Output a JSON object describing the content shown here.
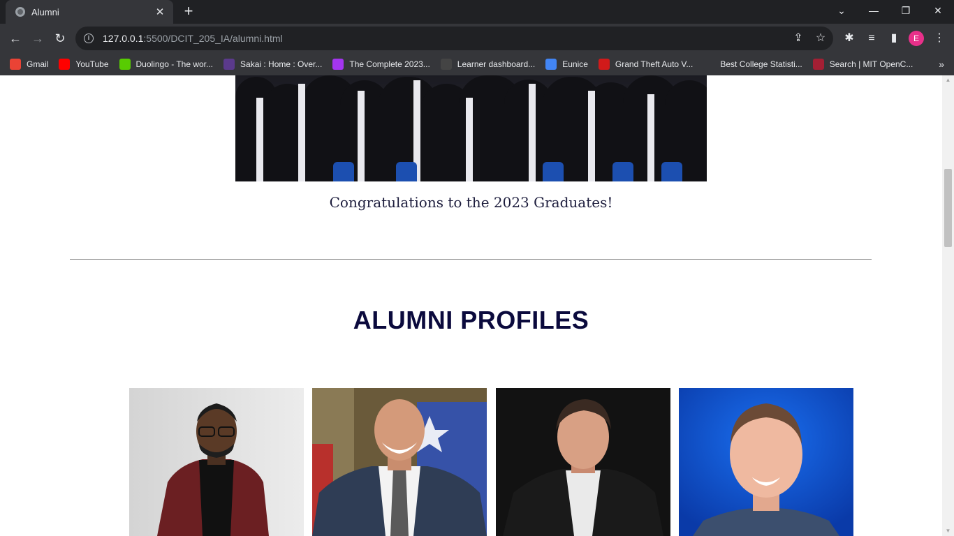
{
  "browser": {
    "tab_title": "Alumni",
    "tab_close": "✕",
    "new_tab": "+",
    "url_host": "127.0.0.1",
    "url_path": ":5500/DCIT_205_IA/alumni.html",
    "profile_initial": "E"
  },
  "bookmarks": [
    {
      "label": "Gmail",
      "icon": "gmail-icon",
      "color": "#ea4335"
    },
    {
      "label": "YouTube",
      "icon": "youtube-icon",
      "color": "#ff0000"
    },
    {
      "label": "Duolingo - The wor...",
      "icon": "duolingo-icon",
      "color": "#58cc02"
    },
    {
      "label": "Sakai : Home : Over...",
      "icon": "sakai-icon",
      "color": "#5b3a8c"
    },
    {
      "label": "The Complete 2023...",
      "icon": "udemy-icon",
      "color": "#a435f0"
    },
    {
      "label": "Learner dashboard...",
      "icon": "alx-icon",
      "color": "#444444"
    },
    {
      "label": "Eunice",
      "icon": "chrome-profile-icon",
      "color": "#4285f4"
    },
    {
      "label": "Grand Theft Auto V...",
      "icon": "gta-icon",
      "color": "#d11a1a"
    },
    {
      "label": "Best College Statisti...",
      "icon": "page-icon",
      "color": "#35363a"
    },
    {
      "label": "Search | MIT OpenC...",
      "icon": "mit-ocw-icon",
      "color": "#a31f34"
    }
  ],
  "page": {
    "caption": "Congratulations to the 2023 Graduates!",
    "section_title": "ALUMNI PROFILES",
    "profiles": [
      {
        "name": "profile-photo-1"
      },
      {
        "name": "profile-photo-2"
      },
      {
        "name": "profile-photo-3"
      },
      {
        "name": "profile-photo-4"
      }
    ]
  }
}
